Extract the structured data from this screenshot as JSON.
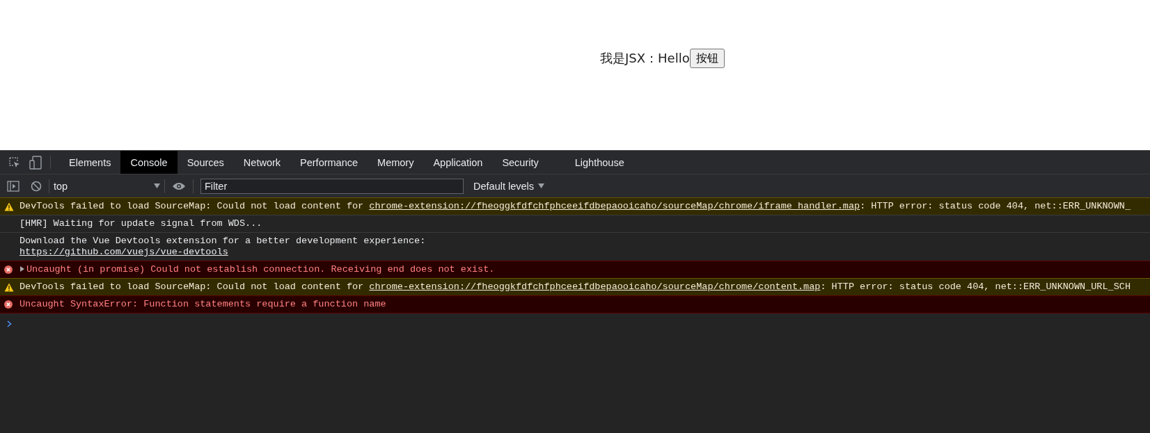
{
  "page": {
    "text": "我是JSX：Hello",
    "button": "按钮"
  },
  "devtools": {
    "tabs": [
      {
        "label": "Elements",
        "selected": false
      },
      {
        "label": "Console",
        "selected": true
      },
      {
        "label": "Sources",
        "selected": false
      },
      {
        "label": "Network",
        "selected": false
      },
      {
        "label": "Performance",
        "selected": false
      },
      {
        "label": "Memory",
        "selected": false
      },
      {
        "label": "Application",
        "selected": false
      },
      {
        "label": "Security",
        "selected": false
      },
      {
        "label": "Lighthouse",
        "selected": false
      }
    ],
    "toolbar": {
      "context": "top",
      "filter_placeholder": "Filter",
      "levels": "Default levels"
    },
    "messages": [
      {
        "kind": "warning",
        "text": "DevTools failed to load SourceMap: Could not load content for ",
        "link": "chrome-extension://fheoggkfdfchfphceeifdbepaooicaho/sourceMap/chrome/iframe_handler.map",
        "rest": ": HTTP error: status code 404, net::ERR_UNKNOWN_"
      },
      {
        "kind": "info",
        "text": "[HMR] Waiting for update signal from WDS..."
      },
      {
        "kind": "info",
        "text": "Download the Vue Devtools extension for a better development experience:",
        "link_line": "https://github.com/vuejs/vue-devtools"
      },
      {
        "kind": "error",
        "expanded": false,
        "text": "Uncaught (in promise) Could not establish connection. Receiving end does not exist."
      },
      {
        "kind": "warning",
        "text": "DevTools failed to load SourceMap: Could not load content for ",
        "link": "chrome-extension://fheoggkfdfchfphceeifdbepaooicaho/sourceMap/chrome/content.map",
        "rest": ": HTTP error: status code 404, net::ERR_UNKNOWN_URL_SCH"
      },
      {
        "kind": "error",
        "text": "Uncaught SyntaxError: Function statements require a function name"
      }
    ]
  }
}
